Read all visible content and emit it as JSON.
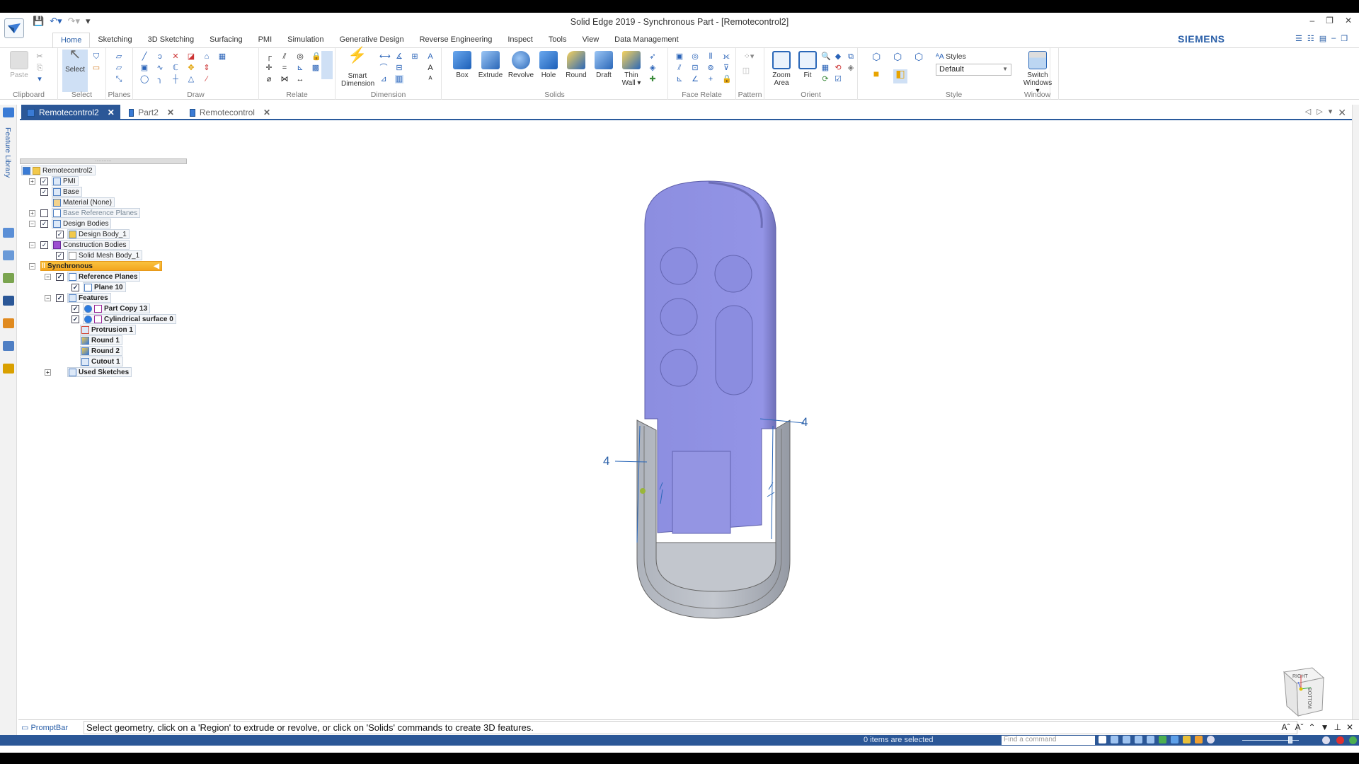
{
  "window": {
    "title": "Solid Edge 2019 - Synchronous Part - [Remotecontrol2]",
    "controls": [
      "minimize",
      "restore",
      "close"
    ]
  },
  "quick_access": {
    "items": [
      "save-icon",
      "undo-icon",
      "redo-icon",
      "customize-icon"
    ]
  },
  "ribbon_tabs": [
    "Home",
    "Sketching",
    "3D Sketching",
    "Surfacing",
    "PMI",
    "Simulation",
    "Generative Design",
    "Reverse Engineering",
    "Inspect",
    "Tools",
    "View",
    "Data Management"
  ],
  "active_ribbon_tab": "Home",
  "brand": "SIEMENS",
  "ribbon": {
    "clipboard": {
      "label": "Clipboard",
      "paste": "Paste"
    },
    "select": {
      "label": "Select",
      "button": "Select"
    },
    "planes": {
      "label": "Planes"
    },
    "draw": {
      "label": "Draw"
    },
    "relate": {
      "label": "Relate"
    },
    "dimension": {
      "label": "Dimension",
      "smart_line1": "Smart",
      "smart_line2": "Dimension"
    },
    "solids": {
      "label": "Solids",
      "buttons": [
        "Box",
        "Extrude",
        "Revolve",
        "Hole",
        "Round",
        "Draft"
      ],
      "thin_line1": "Thin",
      "thin_line2": "Wall ▾"
    },
    "face_relate": {
      "label": "Face Relate"
    },
    "pattern": {
      "label": "Pattern"
    },
    "orient": {
      "label": "Orient",
      "zoom_line1": "Zoom",
      "zoom_line2": "Area",
      "fit": "Fit"
    },
    "style": {
      "label": "Style",
      "styles_label": "Styles",
      "styles_value": "Default"
    },
    "window": {
      "label": "Window",
      "switch_line1": "Switch",
      "switch_line2": "Windows ▾"
    }
  },
  "doc_tabs": [
    {
      "label": "Remotecontrol2",
      "active": true
    },
    {
      "label": "Part2",
      "active": false
    },
    {
      "label": "Remotecontrol",
      "active": false
    }
  ],
  "left_dock": {
    "feature_library": "Feature Library"
  },
  "tree": {
    "root": "Remotecontrol2",
    "nodes": [
      {
        "label": "PMI",
        "expander": "+",
        "checked": true
      },
      {
        "label": "Base",
        "checked": true
      },
      {
        "label": "Material (None)"
      },
      {
        "label": "Base Reference Planes",
        "expander": "+",
        "checked": false
      },
      {
        "label": "Design Bodies",
        "expander": "−",
        "checked": true
      },
      {
        "label": "Design Body_1",
        "checked": true
      },
      {
        "label": "Construction Bodies",
        "expander": "−",
        "checked": true
      },
      {
        "label": "Solid Mesh Body_1",
        "checked": true
      },
      {
        "label": "Synchronous",
        "expander": "−"
      },
      {
        "label": "Reference Planes",
        "expander": "−",
        "checked": true
      },
      {
        "label": "Plane 10",
        "checked": true
      },
      {
        "label": "Features",
        "expander": "−",
        "checked": true
      },
      {
        "label": "Part Copy 13",
        "checked": true
      },
      {
        "label": "Cylindrical surface 0",
        "checked": true
      },
      {
        "label": "Protrusion 1"
      },
      {
        "label": "Round 1"
      },
      {
        "label": "Round 2"
      },
      {
        "label": "Cutout 1"
      },
      {
        "label": "Used Sketches",
        "expander": "+"
      }
    ]
  },
  "viewport": {
    "dimension_left": "4",
    "dimension_right": "4",
    "model_colors": {
      "top_body": "#8e8fe0",
      "base_body": "#b9bec6"
    },
    "viewcube_labels": [
      "RIGHT",
      "BOTTOM"
    ]
  },
  "prompt_bar": {
    "label": "PromptBar",
    "text": "Select geometry, click on a 'Region' to extrude or revolve, or click on 'Solids' commands to create 3D features."
  },
  "status_bar": {
    "selection_text": "0 items are selected",
    "find_placeholder": "Find a command"
  }
}
